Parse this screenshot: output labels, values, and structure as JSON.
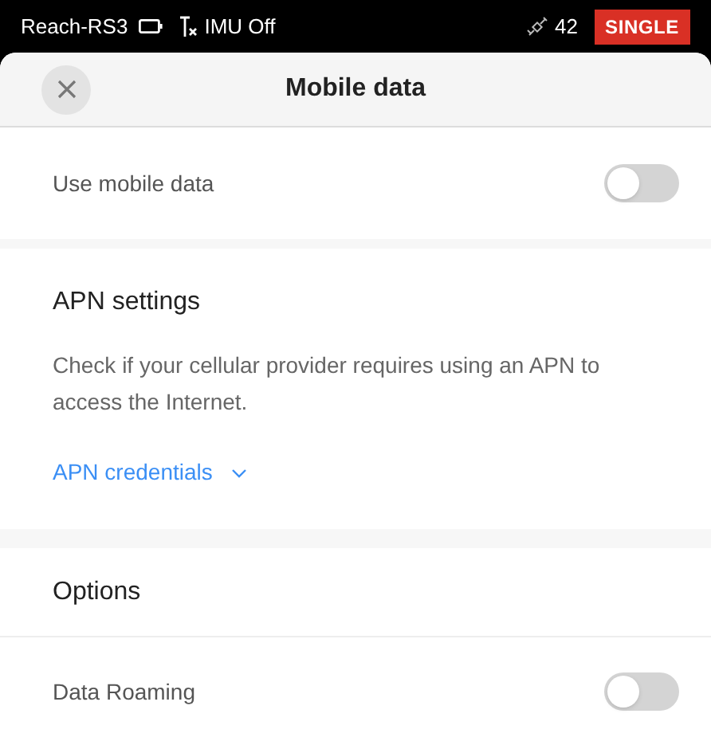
{
  "status_bar": {
    "device": "Reach-RS3",
    "imu": "IMU Off",
    "satellites": "42",
    "solution": "SINGLE"
  },
  "header": {
    "title": "Mobile data"
  },
  "use_mobile_data": {
    "label": "Use mobile data",
    "on": false
  },
  "apn": {
    "title": "APN settings",
    "description": "Check if your cellular provider requires using an APN to access the Internet.",
    "link": "APN credentials",
    "expanded": false
  },
  "options": {
    "title": "Options",
    "items": [
      {
        "label": "Data Roaming",
        "on": false
      }
    ]
  }
}
